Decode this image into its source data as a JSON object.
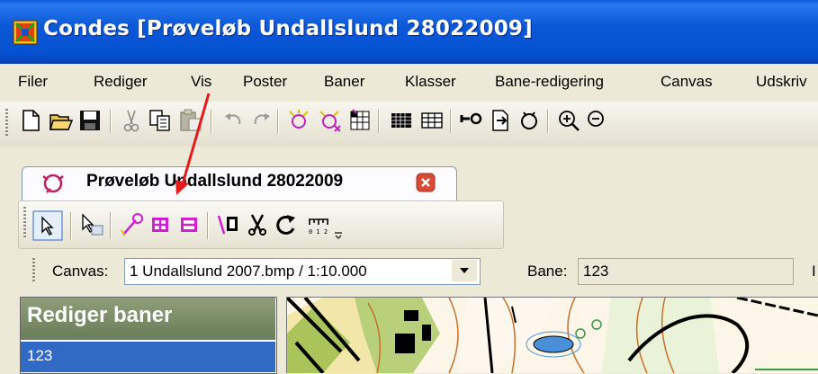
{
  "window": {
    "title": "Condes [Prøveløb Undallslund 28022009]",
    "accent": "#0a5be0"
  },
  "menubar": {
    "items": [
      {
        "label": "Filer"
      },
      {
        "label": "Rediger"
      },
      {
        "label": "Vis"
      },
      {
        "label": "Poster"
      },
      {
        "label": "Baner"
      },
      {
        "label": "Klasser"
      },
      {
        "label": "Bane-redigering"
      },
      {
        "label": "Canvas"
      },
      {
        "label": "Udskriv"
      }
    ]
  },
  "toolbar": {
    "icons": [
      "new-icon",
      "open-icon",
      "save-icon",
      "cut-icon",
      "copy-icon",
      "paste-icon",
      "undo-icon",
      "redo-icon",
      "add-control-icon",
      "delete-control-icon",
      "control-description-icon",
      "grid-icon",
      "table-icon",
      "start-icon",
      "finish-icon",
      "loop-icon",
      "zoom-in-icon",
      "zoom-out-icon"
    ]
  },
  "document_tab": {
    "label": "Prøveløb Undallslund 28022009",
    "close_color": "#d84a38"
  },
  "edit_toolbar": {
    "icons": [
      "select-pointer-icon",
      "select-map-icon",
      "draw-leg-icon",
      "add-marker-icon",
      "remove-marker-icon",
      "map-exchange-icon",
      "cut-course-icon",
      "rotate-icon",
      "ruler-scale-icon",
      "overflow-chevron-icon"
    ]
  },
  "canvasbar": {
    "canvas_label": "Canvas:",
    "canvas_value": "1 Undallslund 2007.bmp   / 1:10.000",
    "bane_label": "Bane:",
    "bane_value": "123",
    "trailing_label": "I"
  },
  "panel": {
    "title": "Rediger baner",
    "items": [
      "123"
    ],
    "selection_color": "#316ac5"
  }
}
